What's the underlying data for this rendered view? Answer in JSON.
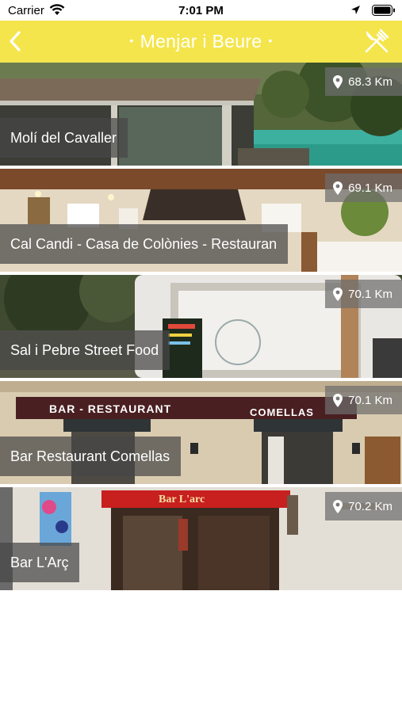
{
  "status_bar": {
    "carrier": "Carrier",
    "time": "7:01 PM"
  },
  "nav": {
    "title": "Menjar i Beure",
    "back_icon": "chevron-left-icon",
    "action_icon": "fork-knife-icon"
  },
  "restaurants": [
    {
      "name": "Molí del Cavaller",
      "distance": "68.3 Km"
    },
    {
      "name": "Cal Candi - Casa de Colònies - Restauran",
      "distance": "69.1 Km"
    },
    {
      "name": "Sal i Pebre Street Food",
      "distance": "70.1 Km"
    },
    {
      "name": "Bar Restaurant Comellas",
      "distance": "70.1 Km"
    },
    {
      "name": "Bar L'Arç",
      "distance": "70.2 Km"
    }
  ],
  "photo_signs": {
    "comellas_top": "BAR - RESTAURANT",
    "comellas_awning": "COMELLAS",
    "larc_awning": "Bar L'arc"
  },
  "colors": {
    "nav_bar": "#f4e54c",
    "badge": "rgba(110,110,110,0.72)",
    "label": "rgba(70,70,70,0.72)"
  }
}
